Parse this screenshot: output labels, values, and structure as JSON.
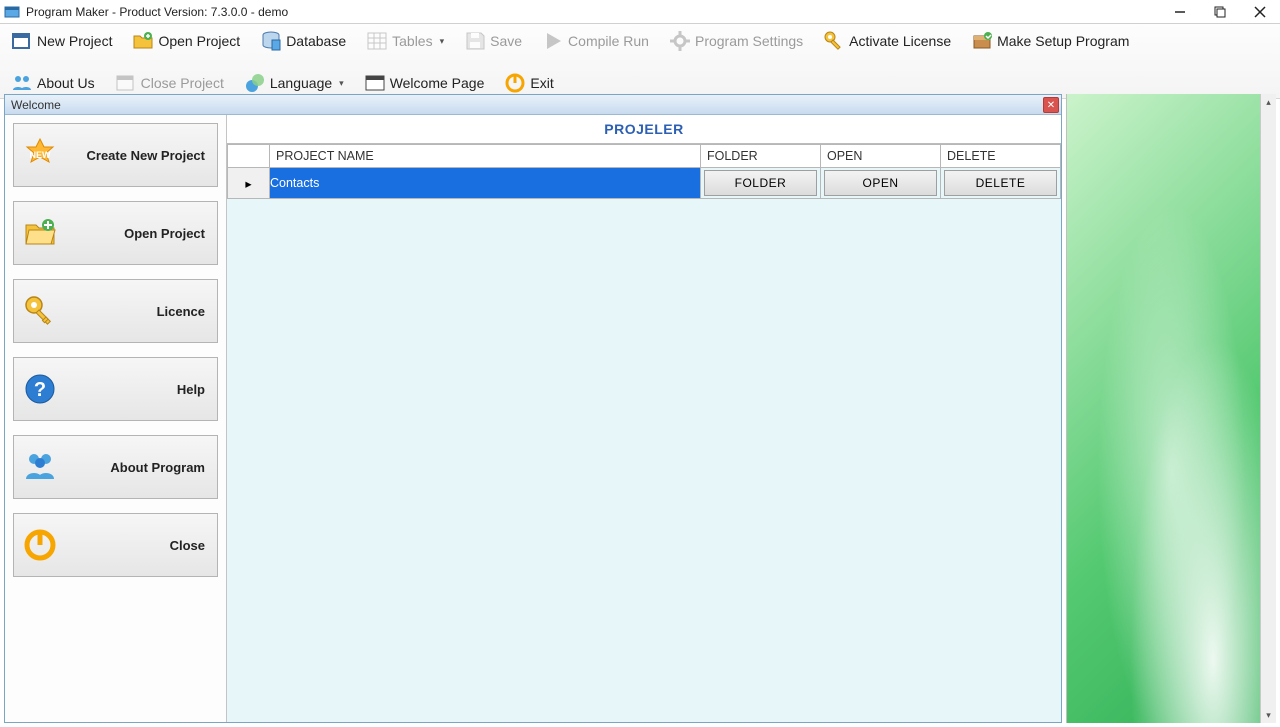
{
  "title": "Program Maker - Product Version: 7.3.0.0 - demo",
  "toolbar": {
    "new_project": "New Project",
    "open_project": "Open Project",
    "database": "Database",
    "tables": "Tables",
    "save": "Save",
    "compile_run": "Compile  Run",
    "program_settings": "Program Settings",
    "activate_license": "Activate License",
    "make_setup": "Make Setup Program",
    "about_us": "About Us",
    "close_project": "Close Project",
    "language": "Language",
    "welcome_page": "Welcome Page",
    "exit": "Exit"
  },
  "welcome": {
    "title": "Welcome",
    "panel_header": "PROJELER",
    "sidebar": {
      "create_new": "Create New Project",
      "open_project": "Open Project",
      "licence": "Licence",
      "help": "Help",
      "about_program": "About Program",
      "close": "Close"
    },
    "columns": {
      "name": "PROJECT NAME",
      "folder": "FOLDER",
      "open": "OPEN",
      "delete": "DELETE"
    },
    "rows": [
      {
        "name": "Contacts",
        "folder_btn": "FOLDER",
        "open_btn": "OPEN",
        "delete_btn": "DELETE"
      }
    ]
  }
}
